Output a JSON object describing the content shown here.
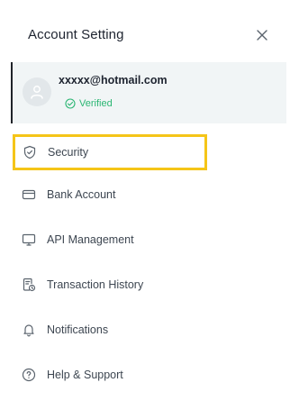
{
  "header": {
    "title": "Account Setting"
  },
  "account": {
    "email": "xxxxx@hotmail.com",
    "status": "Verified"
  },
  "menu": {
    "items": [
      {
        "label": "Security",
        "icon": "shield-check-icon"
      },
      {
        "label": "Bank Account",
        "icon": "credit-card-icon"
      },
      {
        "label": "API Management",
        "icon": "monitor-icon"
      },
      {
        "label": "Transaction History",
        "icon": "document-clock-icon"
      },
      {
        "label": "Notifications",
        "icon": "bell-icon"
      },
      {
        "label": "Help & Support",
        "icon": "question-circle-icon"
      }
    ]
  },
  "colors": {
    "accent_highlight": "#f5c518",
    "verified": "#2bb673",
    "card_bg": "#f1f5f6",
    "text_primary": "#1e2430",
    "icon_gray": "#5a636d"
  }
}
